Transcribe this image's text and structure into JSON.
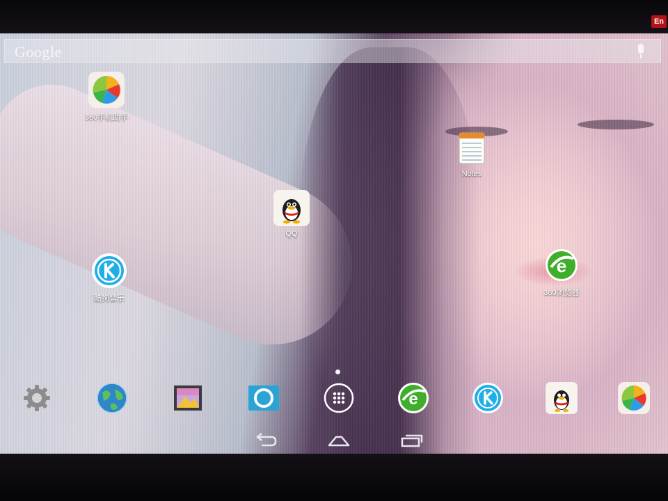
{
  "status": {
    "input_method_badge": "En"
  },
  "search": {
    "logo_text": "Google",
    "mic_icon": "microphone-icon"
  },
  "desktop": {
    "apps": [
      {
        "label": "360手机助手",
        "icon": "360-assistant-icon"
      },
      {
        "label": "Notes",
        "icon": "notes-icon"
      },
      {
        "label": "QQ",
        "icon": "qq-penguin-icon"
      },
      {
        "label": "酷狗音乐",
        "icon": "kugou-music-icon"
      },
      {
        "label": "360浏览器",
        "icon": "360-browser-icon"
      }
    ],
    "page_indicator": {
      "pages": 1,
      "current": 1
    }
  },
  "dock": {
    "items": [
      {
        "name": "settings",
        "icon": "gear-icon"
      },
      {
        "name": "browser",
        "icon": "globe-icon"
      },
      {
        "name": "gallery",
        "icon": "gallery-icon"
      },
      {
        "name": "camera",
        "icon": "camera-icon"
      },
      {
        "name": "all-apps",
        "icon": "app-drawer-icon"
      },
      {
        "name": "360-browser",
        "icon": "360-browser-icon"
      },
      {
        "name": "kugou",
        "icon": "kugou-music-icon"
      },
      {
        "name": "qq",
        "icon": "qq-penguin-icon"
      },
      {
        "name": "360-assistant",
        "icon": "360-assistant-icon"
      }
    ]
  },
  "navbar": {
    "back": "back-icon",
    "home": "home-icon",
    "recents": "recent-apps-icon"
  }
}
